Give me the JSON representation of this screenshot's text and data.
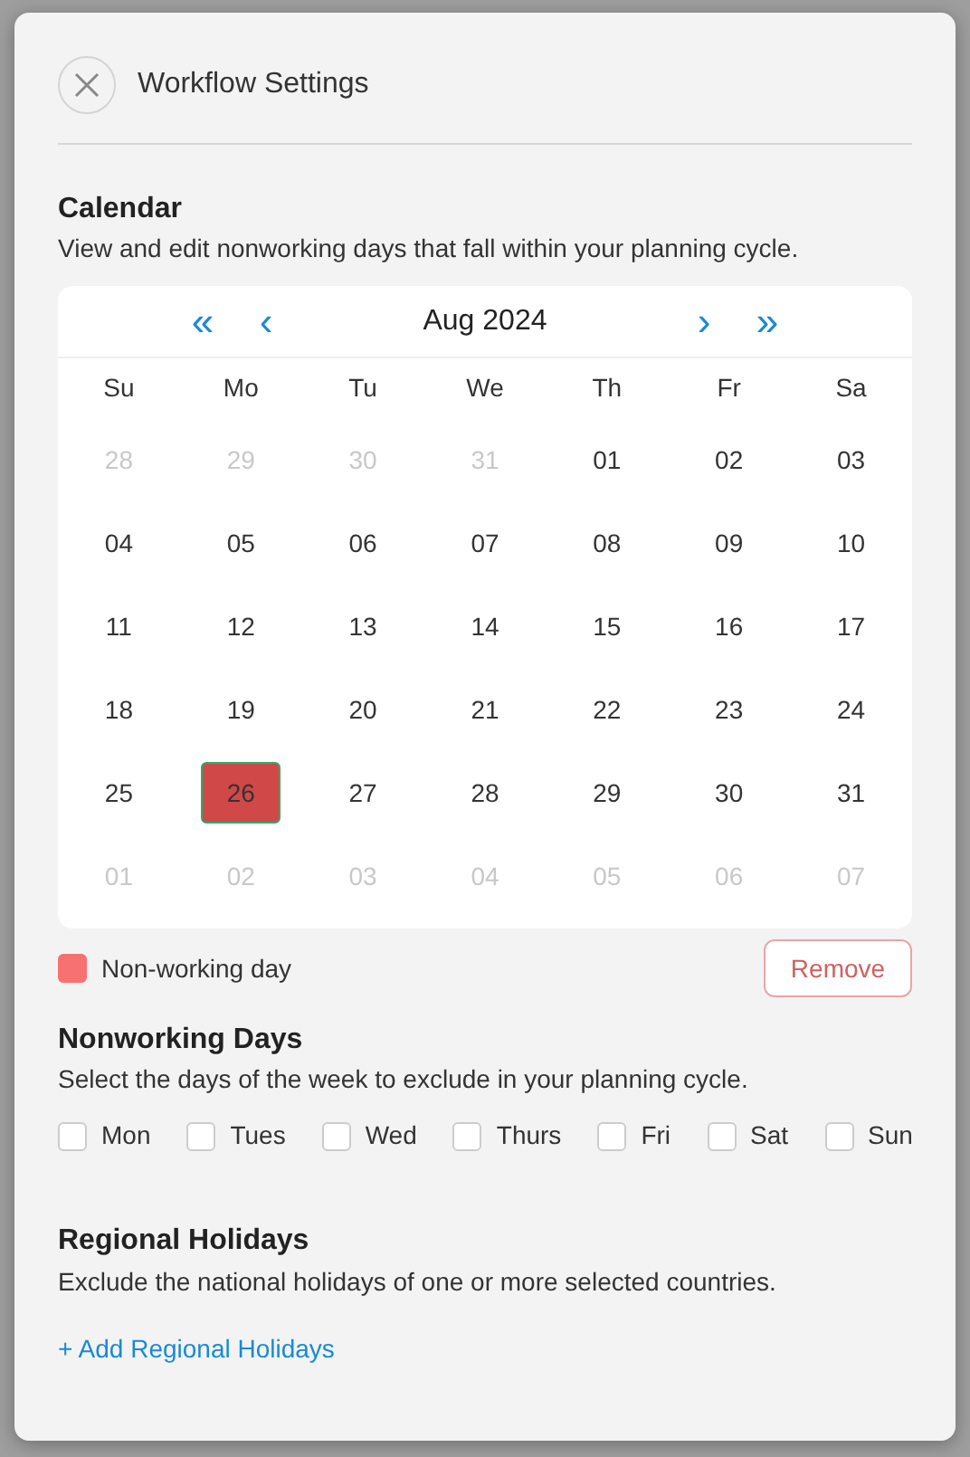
{
  "dialog": {
    "title": "Workflow Settings"
  },
  "calendar": {
    "heading": "Calendar",
    "description": "View and edit nonworking days that fall within your planning cycle.",
    "nav": [
      {
        "kind": "first",
        "label": "«"
      },
      {
        "kind": "prev",
        "label": "‹"
      },
      {
        "kind": "title",
        "label": "Aug 2024"
      },
      {
        "kind": "next",
        "label": "›"
      },
      {
        "kind": "last",
        "label": "»"
      }
    ],
    "weekdays": [
      "Su",
      "Mo",
      "Tu",
      "We",
      "Th",
      "Fr",
      "Sa"
    ],
    "days": [
      {
        "day": "28",
        "outside": true,
        "selected": false
      },
      {
        "day": "29",
        "outside": true,
        "selected": false
      },
      {
        "day": "30",
        "outside": true,
        "selected": false
      },
      {
        "day": "31",
        "outside": true,
        "selected": false
      },
      {
        "day": "01",
        "outside": false,
        "selected": false
      },
      {
        "day": "02",
        "outside": false,
        "selected": false
      },
      {
        "day": "03",
        "outside": false,
        "selected": false
      },
      {
        "day": "04",
        "outside": false,
        "selected": false
      },
      {
        "day": "05",
        "outside": false,
        "selected": false
      },
      {
        "day": "06",
        "outside": false,
        "selected": false
      },
      {
        "day": "07",
        "outside": false,
        "selected": false
      },
      {
        "day": "08",
        "outside": false,
        "selected": false
      },
      {
        "day": "09",
        "outside": false,
        "selected": false
      },
      {
        "day": "10",
        "outside": false,
        "selected": false
      },
      {
        "day": "11",
        "outside": false,
        "selected": false
      },
      {
        "day": "12",
        "outside": false,
        "selected": false
      },
      {
        "day": "13",
        "outside": false,
        "selected": false
      },
      {
        "day": "14",
        "outside": false,
        "selected": false
      },
      {
        "day": "15",
        "outside": false,
        "selected": false
      },
      {
        "day": "16",
        "outside": false,
        "selected": false
      },
      {
        "day": "17",
        "outside": false,
        "selected": false
      },
      {
        "day": "18",
        "outside": false,
        "selected": false
      },
      {
        "day": "19",
        "outside": false,
        "selected": false
      },
      {
        "day": "20",
        "outside": false,
        "selected": false
      },
      {
        "day": "21",
        "outside": false,
        "selected": false
      },
      {
        "day": "22",
        "outside": false,
        "selected": false
      },
      {
        "day": "23",
        "outside": false,
        "selected": false
      },
      {
        "day": "24",
        "outside": false,
        "selected": false
      },
      {
        "day": "25",
        "outside": false,
        "selected": false
      },
      {
        "day": "26",
        "outside": false,
        "selected": true
      },
      {
        "day": "27",
        "outside": false,
        "selected": false
      },
      {
        "day": "28",
        "outside": false,
        "selected": false
      },
      {
        "day": "29",
        "outside": false,
        "selected": false
      },
      {
        "day": "30",
        "outside": false,
        "selected": false
      },
      {
        "day": "31",
        "outside": false,
        "selected": false
      },
      {
        "day": "01",
        "outside": true,
        "selected": false
      },
      {
        "day": "02",
        "outside": true,
        "selected": false
      },
      {
        "day": "03",
        "outside": true,
        "selected": false
      },
      {
        "day": "04",
        "outside": true,
        "selected": false
      },
      {
        "day": "05",
        "outside": true,
        "selected": false
      },
      {
        "day": "06",
        "outside": true,
        "selected": false
      },
      {
        "day": "07",
        "outside": true,
        "selected": false
      }
    ],
    "legend": {
      "label": "Non-working day",
      "color": "#f87171"
    },
    "remove_button": "Remove"
  },
  "nonworking_days": {
    "heading": "Nonworking Days",
    "description": "Select the days of the week to exclude in your planning cycle.",
    "options": [
      {
        "label": "Mon",
        "checked": false
      },
      {
        "label": "Tues",
        "checked": false
      },
      {
        "label": "Wed",
        "checked": false
      },
      {
        "label": "Thurs",
        "checked": false
      },
      {
        "label": "Fri",
        "checked": false
      },
      {
        "label": "Sat",
        "checked": false
      },
      {
        "label": "Sun",
        "checked": false
      }
    ]
  },
  "regional_holidays": {
    "heading": "Regional Holidays",
    "description": "Exclude the national holidays of one or more selected countries.",
    "add_link": "+ Add Regional Holidays"
  }
}
